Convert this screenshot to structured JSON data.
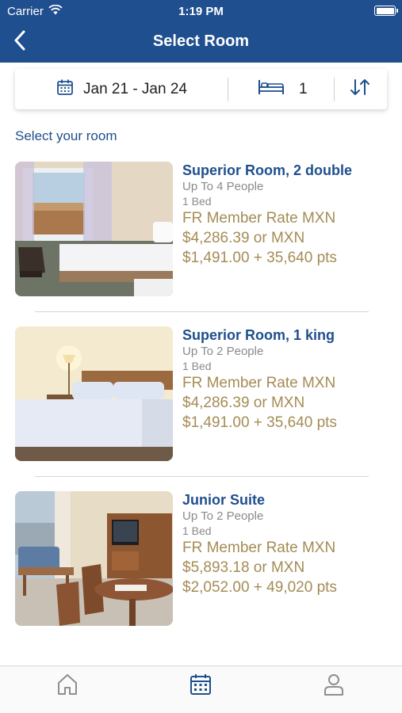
{
  "status_bar": {
    "carrier": "Carrier",
    "time": "1:19 PM"
  },
  "header": {
    "title": "Select Room",
    "back_icon": "chevron-left-icon"
  },
  "search": {
    "date_range": "Jan 21 - Jan 24",
    "date_icon": "calendar-icon",
    "beds": "1",
    "bed_icon": "bed-icon",
    "sort_icon": "sort-icon"
  },
  "section_label": "Select your room",
  "rooms": [
    {
      "name": "Superior Room, 2 double",
      "people": "Up To 4 People",
      "beds": "1 Bed",
      "rate_label": "FR Member Rate MXN",
      "price": "$4,286.39 or MXN",
      "points": "$1,491.00 + 35,640 pts"
    },
    {
      "name": "Superior Room, 1 king",
      "people": "Up To 2 People",
      "beds": "1 Bed",
      "rate_label": "FR Member Rate MXN",
      "price": "$4,286.39 or MXN",
      "points": "$1,491.00 + 35,640 pts"
    },
    {
      "name": "Junior Suite",
      "people": "Up To 2 People",
      "beds": "1 Bed",
      "rate_label": "FR Member Rate MXN",
      "price": "$5,893.18 or MXN",
      "points": "$2,052.00 + 49,020 pts"
    }
  ],
  "tabbar": {
    "items": [
      {
        "icon": "home-icon",
        "active": false
      },
      {
        "icon": "calendar-icon",
        "active": true
      },
      {
        "icon": "profile-icon",
        "active": false
      }
    ]
  },
  "colors": {
    "brand": "#1f4f8e",
    "price": "#a48c55",
    "muted": "#8a8a8a"
  }
}
